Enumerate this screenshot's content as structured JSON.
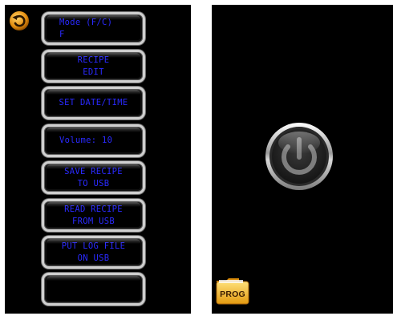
{
  "left_panel": {
    "back_icon": "undo-arrow-icon",
    "buttons": [
      {
        "lines": [
          "Mode (F/C)",
          "F"
        ],
        "align": "left"
      },
      {
        "lines": [
          "RECIPE",
          "EDIT"
        ],
        "align": "center"
      },
      {
        "lines": [
          "SET DATE/TIME"
        ],
        "align": "center"
      },
      {
        "lines": [
          "Volume: 10"
        ],
        "align": "left"
      },
      {
        "lines": [
          "SAVE RECIPE",
          "TO USB"
        ],
        "align": "center"
      },
      {
        "lines": [
          "READ RECIPE",
          "FROM USB"
        ],
        "align": "center"
      },
      {
        "lines": [
          "PUT LOG FILE",
          "ON USB"
        ],
        "align": "center"
      },
      {
        "lines": [],
        "align": "center"
      }
    ]
  },
  "right_panel": {
    "power_icon": "power-icon",
    "prog_label": "PROG"
  },
  "colors": {
    "screen_bg": "#000000",
    "button_text": "#2a2aff",
    "button_border": "#cfcfcf",
    "back_icon": "#f0a020",
    "folder": "#f2b21e"
  }
}
